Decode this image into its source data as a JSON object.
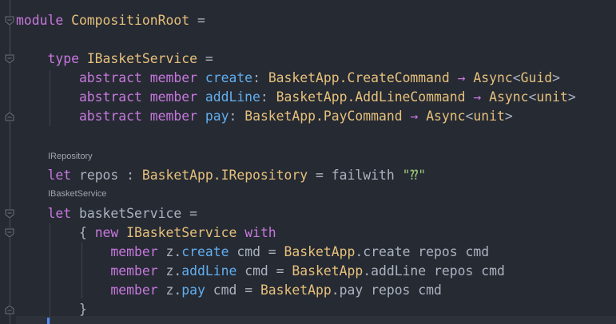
{
  "editor": {
    "hints": [
      "IRepository",
      "IBasketService"
    ],
    "lines": [
      [
        [
          "module ",
          "kw"
        ],
        [
          "CompositionRoot",
          "ty"
        ],
        [
          " =",
          "pl"
        ]
      ],
      [
        [
          "    type ",
          "kw"
        ],
        [
          "IBasketService",
          "ty"
        ],
        [
          " =",
          "pl"
        ]
      ],
      [
        [
          "        abstract member ",
          "kw"
        ],
        [
          "create",
          "id"
        ],
        [
          ": ",
          "pl"
        ],
        [
          "BasketApp.CreateCommand",
          "ty"
        ],
        [
          " → ",
          "ar"
        ],
        [
          "Async",
          "ty"
        ],
        [
          "<",
          "pl"
        ],
        [
          "Guid",
          "ty"
        ],
        [
          ">",
          "pl"
        ]
      ],
      [
        [
          "        abstract member ",
          "kw"
        ],
        [
          "addLine",
          "id"
        ],
        [
          ": ",
          "pl"
        ],
        [
          "BasketApp.AddLineCommand",
          "ty"
        ],
        [
          " → ",
          "ar"
        ],
        [
          "Async",
          "ty"
        ],
        [
          "<",
          "pl"
        ],
        [
          "unit",
          "ty"
        ],
        [
          ">",
          "pl"
        ]
      ],
      [
        [
          "        abstract member ",
          "kw"
        ],
        [
          "pay",
          "id"
        ],
        [
          ": ",
          "pl"
        ],
        [
          "BasketApp.PayCommand",
          "ty"
        ],
        [
          " → ",
          "ar"
        ],
        [
          "Async",
          "ty"
        ],
        [
          "<",
          "pl"
        ],
        [
          "unit",
          "ty"
        ],
        [
          ">",
          "pl"
        ]
      ],
      [
        [
          "    let ",
          "kw"
        ],
        [
          "repos : ",
          "pl"
        ],
        [
          "BasketApp.IRepository",
          "ty"
        ],
        [
          " = failwith ",
          "pl"
        ],
        [
          "\"⁇\"",
          "st"
        ]
      ],
      [
        [
          "    let ",
          "kw"
        ],
        [
          "basketService =",
          "pl"
        ]
      ],
      [
        [
          "        { ",
          "pl"
        ],
        [
          "new ",
          "kw"
        ],
        [
          "IBasketService ",
          "ty"
        ],
        [
          "with",
          "kw"
        ]
      ],
      [
        [
          "            member ",
          "kw"
        ],
        [
          "z.",
          "pl"
        ],
        [
          "create",
          "id"
        ],
        [
          " cmd = ",
          "pl"
        ],
        [
          "BasketApp",
          "ty"
        ],
        [
          ".create repos cmd",
          "pl"
        ]
      ],
      [
        [
          "            member ",
          "kw"
        ],
        [
          "z.",
          "pl"
        ],
        [
          "addLine",
          "id"
        ],
        [
          " cmd = ",
          "pl"
        ],
        [
          "BasketApp",
          "ty"
        ],
        [
          ".addLine repos cmd",
          "pl"
        ]
      ],
      [
        [
          "            member ",
          "kw"
        ],
        [
          "z.",
          "pl"
        ],
        [
          "pay",
          "id"
        ],
        [
          " cmd = ",
          "pl"
        ],
        [
          "BasketApp",
          "ty"
        ],
        [
          ".pay repos cmd",
          "pl"
        ]
      ],
      [
        [
          "        }",
          "pl"
        ]
      ]
    ]
  }
}
